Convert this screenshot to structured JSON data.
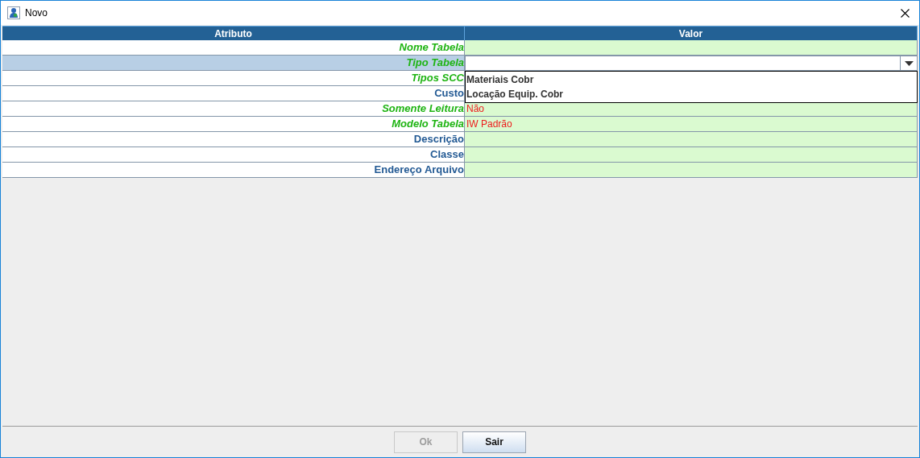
{
  "window": {
    "title": "Novo"
  },
  "table": {
    "columns": [
      "Atributo",
      "Valor"
    ],
    "rows": [
      {
        "attribute": "Nome Tabela",
        "required": true,
        "selected": false
      },
      {
        "attribute": "Tipo Tabela",
        "required": true,
        "selected": true,
        "kind": "combo",
        "options": [
          "Materiais Cobr",
          "Locação Equip. Cobr"
        ]
      },
      {
        "attribute": "Tipos SCC",
        "required": true,
        "selected": false
      },
      {
        "attribute": "Custo",
        "required": false,
        "selected": false
      },
      {
        "attribute": "Somente Leitura",
        "required": true,
        "selected": false,
        "value": "Não"
      },
      {
        "attribute": "Modelo Tabela",
        "required": true,
        "selected": false,
        "value": "IW Padrão"
      },
      {
        "attribute": "Descrição",
        "required": false,
        "selected": false
      },
      {
        "attribute": "Classe",
        "required": false,
        "selected": false
      },
      {
        "attribute": "Endereço Arquivo",
        "required": false,
        "selected": false
      }
    ]
  },
  "buttons": [
    {
      "label": "Ok",
      "disabled": true
    },
    {
      "label": "Sair",
      "disabled": false
    }
  ]
}
